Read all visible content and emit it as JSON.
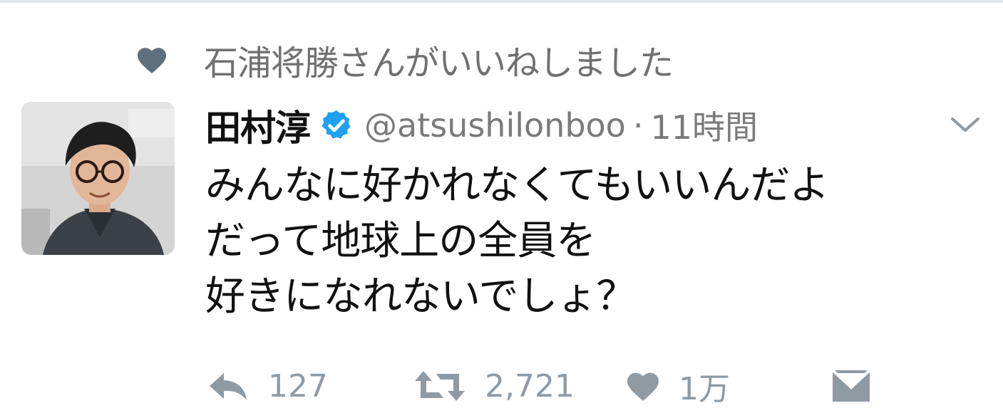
{
  "social_context": {
    "icon": "heart-icon",
    "text": "石浦将勝さんがいいねしました"
  },
  "tweet": {
    "author": {
      "display_name": "田村淳",
      "verified": true,
      "handle": "@atsushilonboo",
      "avatar": "avatar"
    },
    "separator": "·",
    "timestamp": "11時間",
    "body_lines": [
      "みんなに好かれなくてもいいんだよ",
      "だって地球上の全員を",
      "好きになれないでしょ？"
    ],
    "actions": {
      "reply": {
        "icon": "reply-icon",
        "count": "127"
      },
      "retweet": {
        "icon": "retweet-icon",
        "count": "2,721"
      },
      "like": {
        "icon": "heart-icon",
        "count": "1万"
      },
      "dm": {
        "icon": "envelope-icon"
      }
    }
  },
  "colors": {
    "icon_gray": "#8f9aa3",
    "verified_blue": "#1da1f2",
    "liked_heart": "#5f6f7d"
  }
}
